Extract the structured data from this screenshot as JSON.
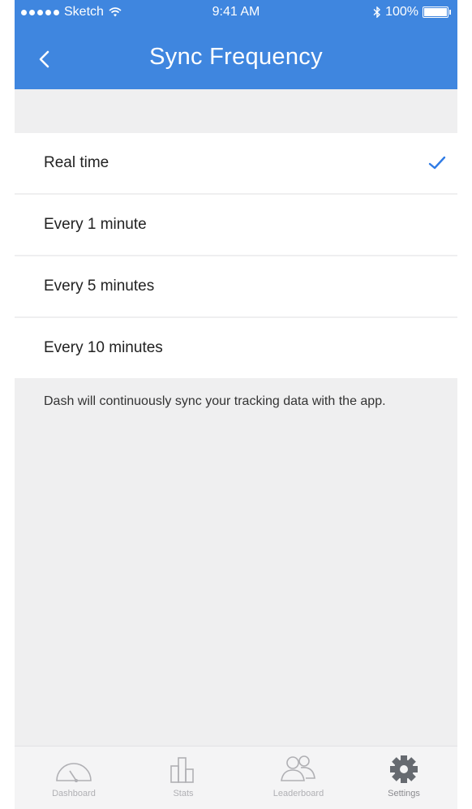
{
  "status_bar": {
    "carrier": "Sketch",
    "time": "9:41 AM",
    "battery": "100%"
  },
  "nav": {
    "title": "Sync Frequency"
  },
  "options": [
    {
      "label": "Real time",
      "selected": true
    },
    {
      "label": "Every 1 minute",
      "selected": false
    },
    {
      "label": "Every 5 minutes",
      "selected": false
    },
    {
      "label": "Every 10 minutes",
      "selected": false
    }
  ],
  "note": "Dash will continuously sync your tracking data with the app.",
  "tabs": [
    {
      "label": "Dashboard",
      "icon": "dashboard-gauge-icon"
    },
    {
      "label": "Stats",
      "icon": "bar-chart-icon"
    },
    {
      "label": "Leaderboard",
      "icon": "people-icon"
    },
    {
      "label": "Settings",
      "icon": "gear-icon",
      "active": true
    }
  ],
  "colors": {
    "accent": "#3f86df",
    "background": "#efeff0",
    "check": "#2f7be5"
  }
}
